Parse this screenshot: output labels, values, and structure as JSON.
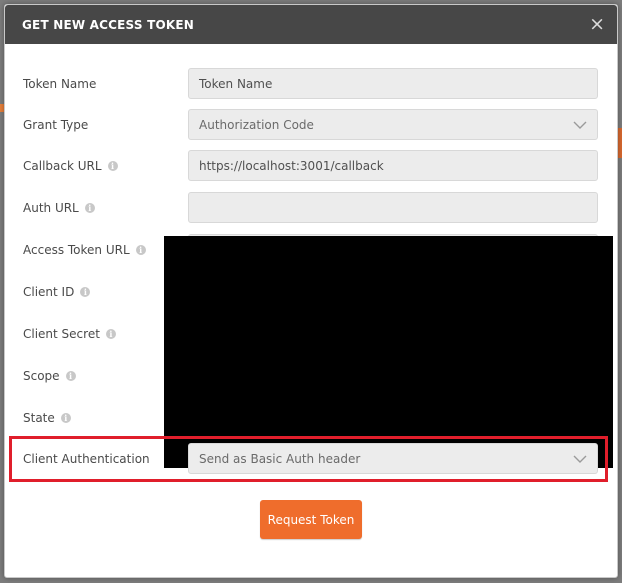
{
  "dialog": {
    "title": "GET NEW ACCESS TOKEN",
    "close_glyph": "×"
  },
  "fields": {
    "token_name": {
      "label": "Token Name",
      "placeholder": "Token Name",
      "value": ""
    },
    "grant_type": {
      "label": "Grant Type",
      "value": "Authorization Code"
    },
    "callback_url": {
      "label": "Callback URL",
      "value": "https://localhost:3001/callback"
    },
    "auth_url": {
      "label": "Auth URL"
    },
    "access_token_url": {
      "label": "Access Token URL"
    },
    "client_id": {
      "label": "Client ID"
    },
    "client_secret": {
      "label": "Client Secret"
    },
    "scope": {
      "label": "Scope"
    },
    "state": {
      "label": "State"
    },
    "client_authentication": {
      "label": "Client Authentication",
      "value": "Send as Basic Auth header"
    }
  },
  "info_glyph": "i",
  "request_button": {
    "label": "Request Token"
  },
  "colors": {
    "header_bg": "#474747",
    "accent_orange": "#ef6d2c",
    "highlight_red": "#e01e2b",
    "redaction": "#000000"
  }
}
